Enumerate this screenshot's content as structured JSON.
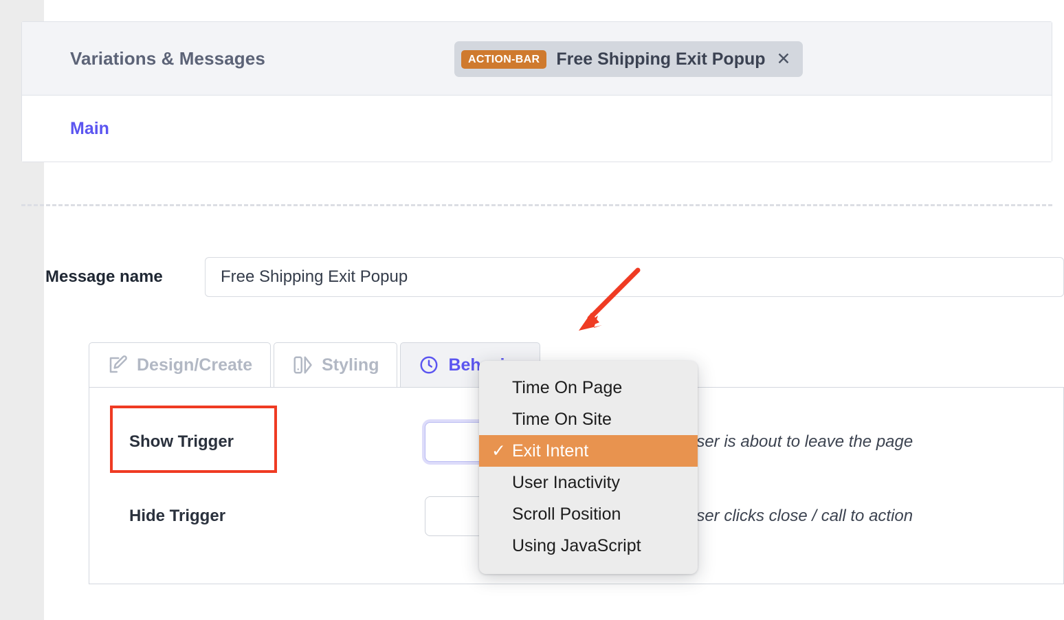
{
  "variations_card": {
    "header_title": "Variations & Messages",
    "variation_link": "Main",
    "chip": {
      "badge": "ACTION-BAR",
      "label": "Free Shipping Exit Popup",
      "close_glyph": "✕",
      "badge_color": "#cf7a2e",
      "chip_bg": "#d3d7de"
    }
  },
  "message_name": {
    "label": "Message name",
    "value": "Free Shipping Exit Popup",
    "placeholder": "Message name"
  },
  "tabs": [
    {
      "label": "Design/Create",
      "icon": "edit-square-icon",
      "active": false
    },
    {
      "label": "Styling",
      "icon": "shapes-icon",
      "active": false
    },
    {
      "label": "Behavior",
      "icon": "clock-icon",
      "active": true
    }
  ],
  "behavior_panel": {
    "rows": [
      {
        "label": "Show Trigger",
        "selected_value": "Exit Intent",
        "hint": "User is about to leave the page"
      },
      {
        "label": "Hide Trigger",
        "selected_value": "",
        "hint": "User clicks close / call to action"
      }
    ]
  },
  "trigger_dropdown": {
    "open": true,
    "selected": "Exit Intent",
    "check_glyph": "✓",
    "highlight_color": "#e8934f",
    "items": [
      "Time On Page",
      "Time On Site",
      "Exit Intent",
      "User Inactivity",
      "Scroll Position",
      "Using JavaScript"
    ]
  },
  "annotations": {
    "highlight_box_target": "Show Trigger",
    "highlight_color": "#ef3b23",
    "arrow_target": "Behavior tab",
    "arrow_color": "#ef3b23"
  },
  "theme": {
    "accent_purple": "#5b55f0",
    "muted_text": "#b2b8c4",
    "header_bg": "#f3f4f7",
    "border": "#d3d7de"
  }
}
